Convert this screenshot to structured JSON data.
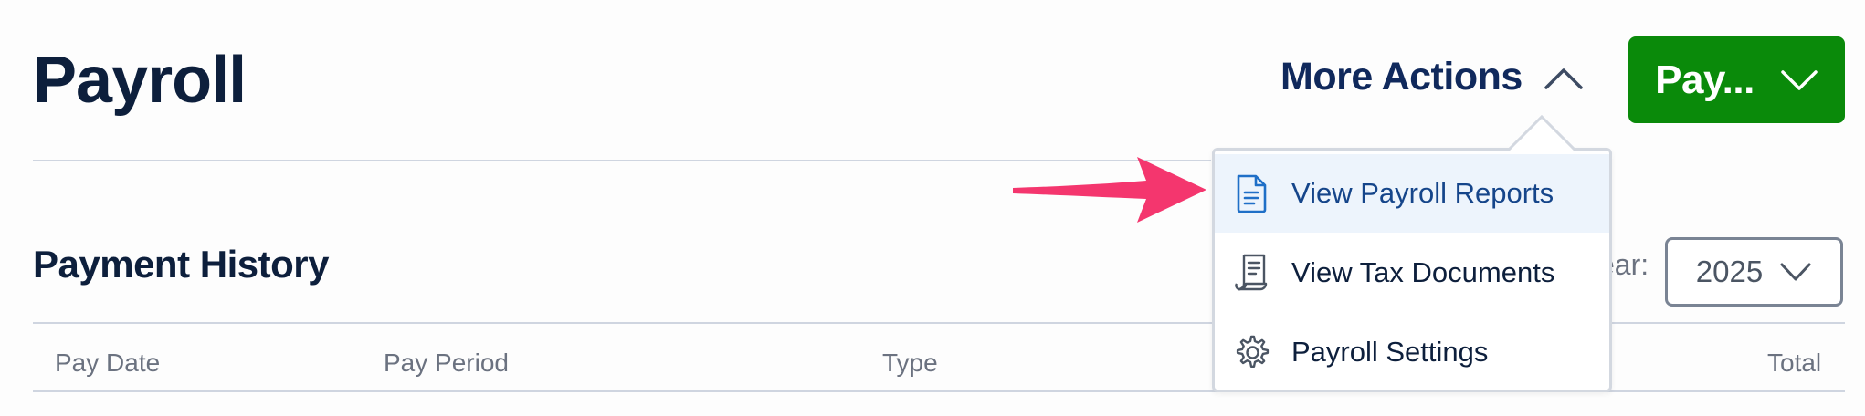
{
  "header": {
    "title": "Payroll",
    "more_actions_label": "More Actions",
    "more_actions_icon": "chevron-up-icon",
    "pay_button_label": "Pay...",
    "pay_button_icon": "chevron-down-icon"
  },
  "colors": {
    "brand_navy": "#0d1f3c",
    "pay_green": "#0a8a0a",
    "highlight_bg": "#edf4fc",
    "annotation_arrow": "#f4366e"
  },
  "menu": {
    "items": [
      {
        "label": "View Payroll Reports",
        "icon": "document-icon",
        "highlighted": true
      },
      {
        "label": "View Tax Documents",
        "icon": "scroll-icon",
        "highlighted": false
      },
      {
        "label": "Payroll Settings",
        "icon": "gear-icon",
        "highlighted": false
      }
    ]
  },
  "payment_history": {
    "title": "Payment History",
    "year_label": "ear:",
    "year_value": "2025",
    "columns": [
      "Pay Date",
      "Pay Period",
      "Type",
      "Total"
    ]
  }
}
